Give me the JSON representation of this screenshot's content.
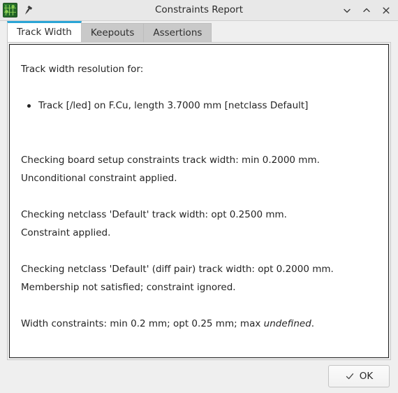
{
  "window": {
    "title": "Constraints Report",
    "app_icon": "kicad-pcb-icon",
    "pin_icon": "pin-icon",
    "controls": [
      {
        "name": "minimize-button",
        "icon": "chevron-down-icon"
      },
      {
        "name": "maximize-button",
        "icon": "chevron-up-icon"
      },
      {
        "name": "close-button",
        "icon": "close-icon"
      }
    ]
  },
  "tabs": [
    {
      "label": "Track Width",
      "active": true
    },
    {
      "label": "Keepouts",
      "active": false
    },
    {
      "label": "Assertions",
      "active": false
    }
  ],
  "report": {
    "heading": "Track width resolution for:",
    "bullet": "Track [/led] on F.Cu, length 3.7000 mm [netclass Default]",
    "group1_line1": "Checking board setup constraints track width: min 0.2000 mm.",
    "group1_line2": "Unconditional constraint applied.",
    "group2_line1": "Checking netclass 'Default' track width: opt 0.2500 mm.",
    "group2_line2": "Constraint applied.",
    "group3_line1": "Checking netclass 'Default' (diff pair) track width: opt 0.2000 mm.",
    "group3_line2": "Membership not satisfied; constraint ignored.",
    "summary_prefix": "Width constraints: min 0.2 mm; opt 0.25 mm; max ",
    "summary_italic": "undefined",
    "summary_suffix": "."
  },
  "footer": {
    "ok_label": "OK",
    "ok_icon": "check-icon"
  },
  "colors": {
    "accent": "#2aa5d6",
    "window_bg": "#efefef",
    "titlebar_bg": "#e8e8e8",
    "panel_bg": "#ffffff",
    "text": "#242424"
  }
}
